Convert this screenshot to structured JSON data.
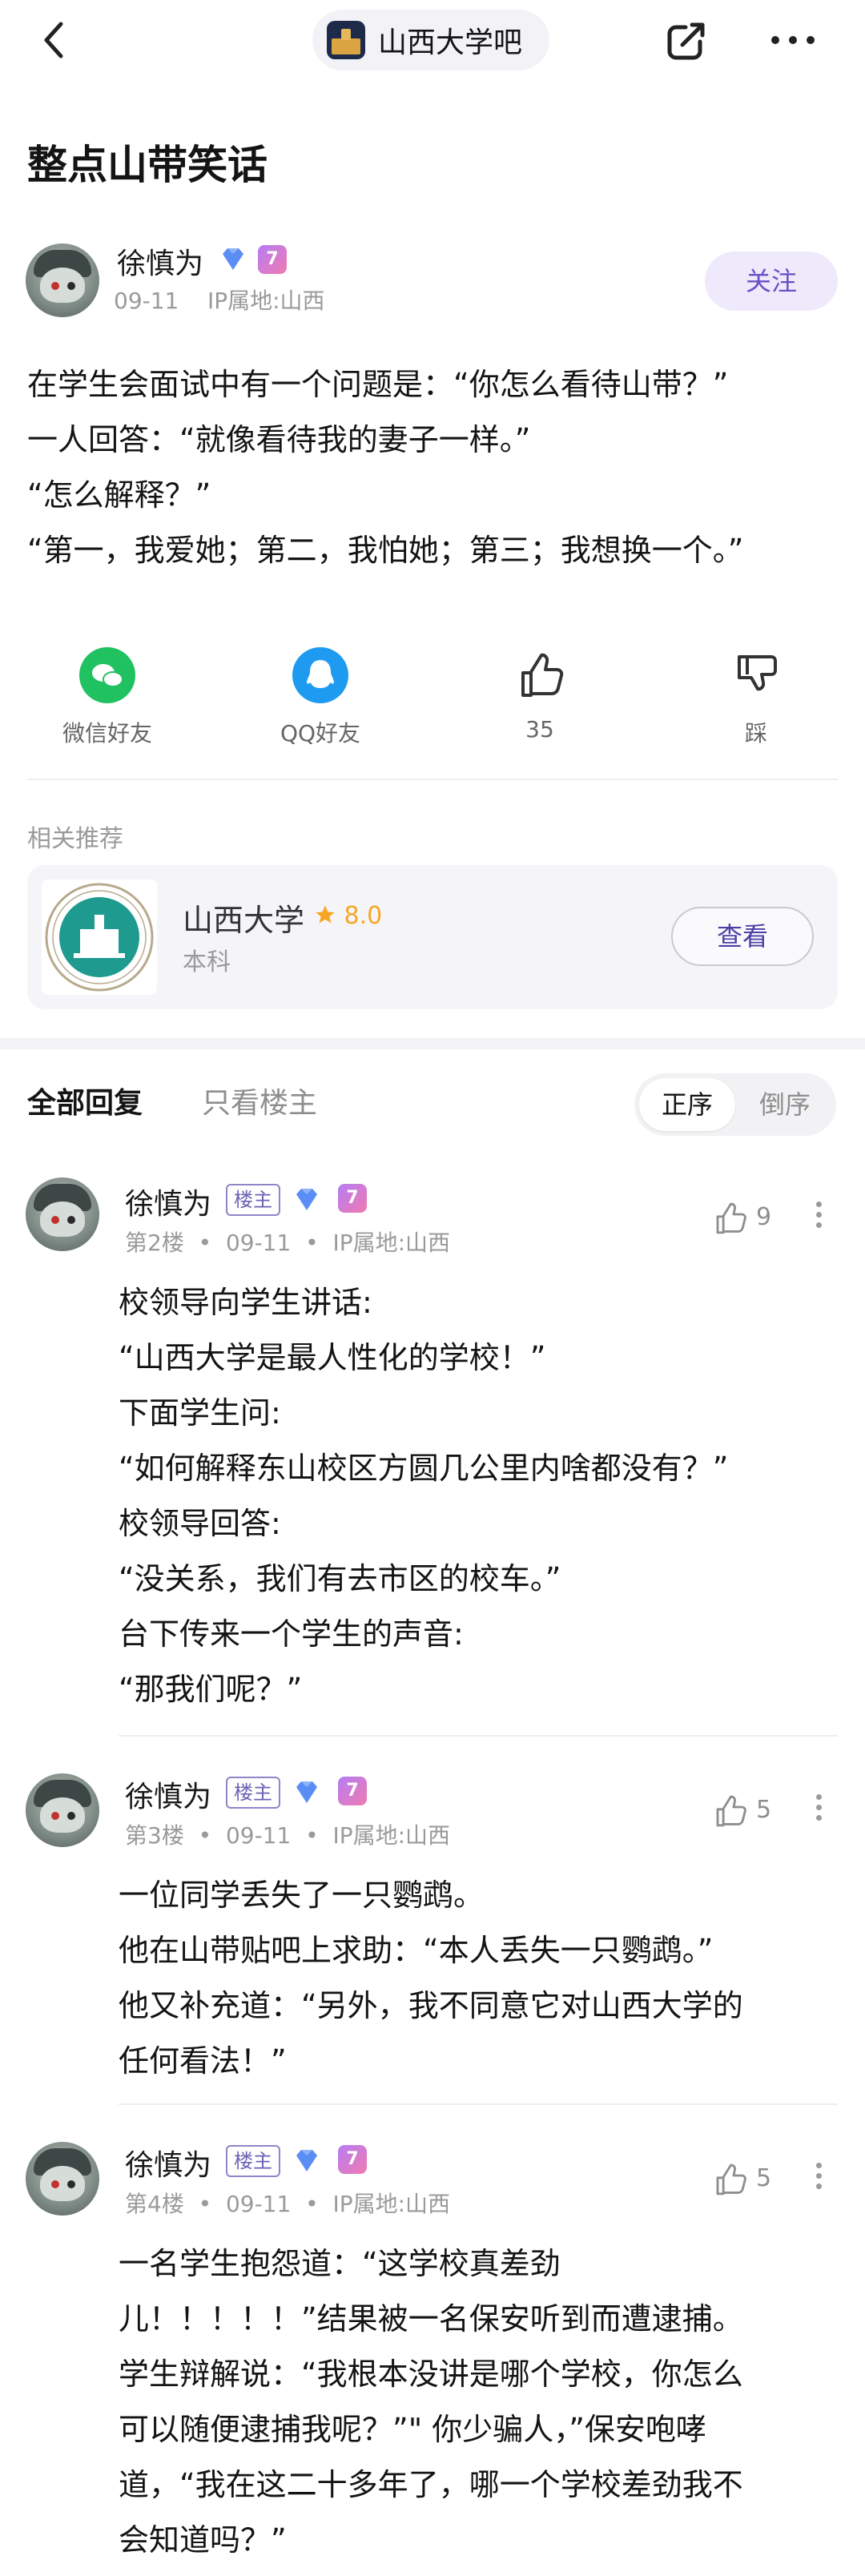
{
  "topbar": {
    "forum_name": "山西大学吧"
  },
  "post": {
    "title": "整点山带笑话",
    "author": {
      "name": "徐慎为",
      "level_badge": "7",
      "date": "09-11",
      "ip": "IP属地:山西"
    },
    "follow_label": "关注",
    "body": [
      "在学生会面试中有一个问题是：“你怎么看待山带？”",
      "一人回答：“就像看待我的妻子一样。”",
      "“怎么解释？”",
      "“第一，我爱她；第二，我怕她；第三；我想换一个。”"
    ]
  },
  "share_row": {
    "wechat": "微信好友",
    "qq": "QQ好友",
    "likes": "35",
    "dislike": "踩"
  },
  "related": {
    "label": "相关推荐",
    "school_name": "山西大学",
    "rating": "8.0",
    "school_type": "本科",
    "view_label": "查看"
  },
  "replies_header": {
    "tab_all": "全部回复",
    "tab_host_only": "只看楼主",
    "sort_asc": "正序",
    "sort_desc": "倒序"
  },
  "replies": [
    {
      "author": "徐慎为",
      "host_tag": "楼主",
      "level_badge": "7",
      "floor": "第2楼",
      "date": "09-11",
      "ip": "IP属地:山西",
      "likes": "9",
      "lines": [
        "校领导向学生讲话:",
        "“山西大学是最人性化的学校！”",
        "下面学生问:",
        "“如何解释东山校区方圆几公里内啥都没有？”",
        "校领导回答:",
        "“没关系，我们有去市区的校车。”",
        "台下传来一个学生的声音:",
        "“那我们呢？”"
      ]
    },
    {
      "author": "徐慎为",
      "host_tag": "楼主",
      "level_badge": "7",
      "floor": "第3楼",
      "date": "09-11",
      "ip": "IP属地:山西",
      "likes": "5",
      "lines": [
        "一位同学丢失了一只鹦鹉。",
        "他在山带贴吧上求助：“本人丢失一只鹦鹉。”",
        "他又补充道：“另外，我不同意它对山西大学的",
        "任何看法！”"
      ]
    },
    {
      "author": "徐慎为",
      "host_tag": "楼主",
      "level_badge": "7",
      "floor": "第4楼",
      "date": "09-11",
      "ip": "IP属地:山西",
      "likes": "5",
      "lines": [
        "一名学生抱怨道：“这学校真差劲",
        "儿！！！！！”结果被一名保安听到而遭逮捕。",
        "学生辩解说：“我根本没讲是哪个学校，你怎么",
        "可以随便逮捕我呢？”\" 你少骗人，”保安咆哮",
        "道，“我在这二十多年了，哪一个学校差劲我不",
        "会知道吗？”"
      ]
    }
  ]
}
